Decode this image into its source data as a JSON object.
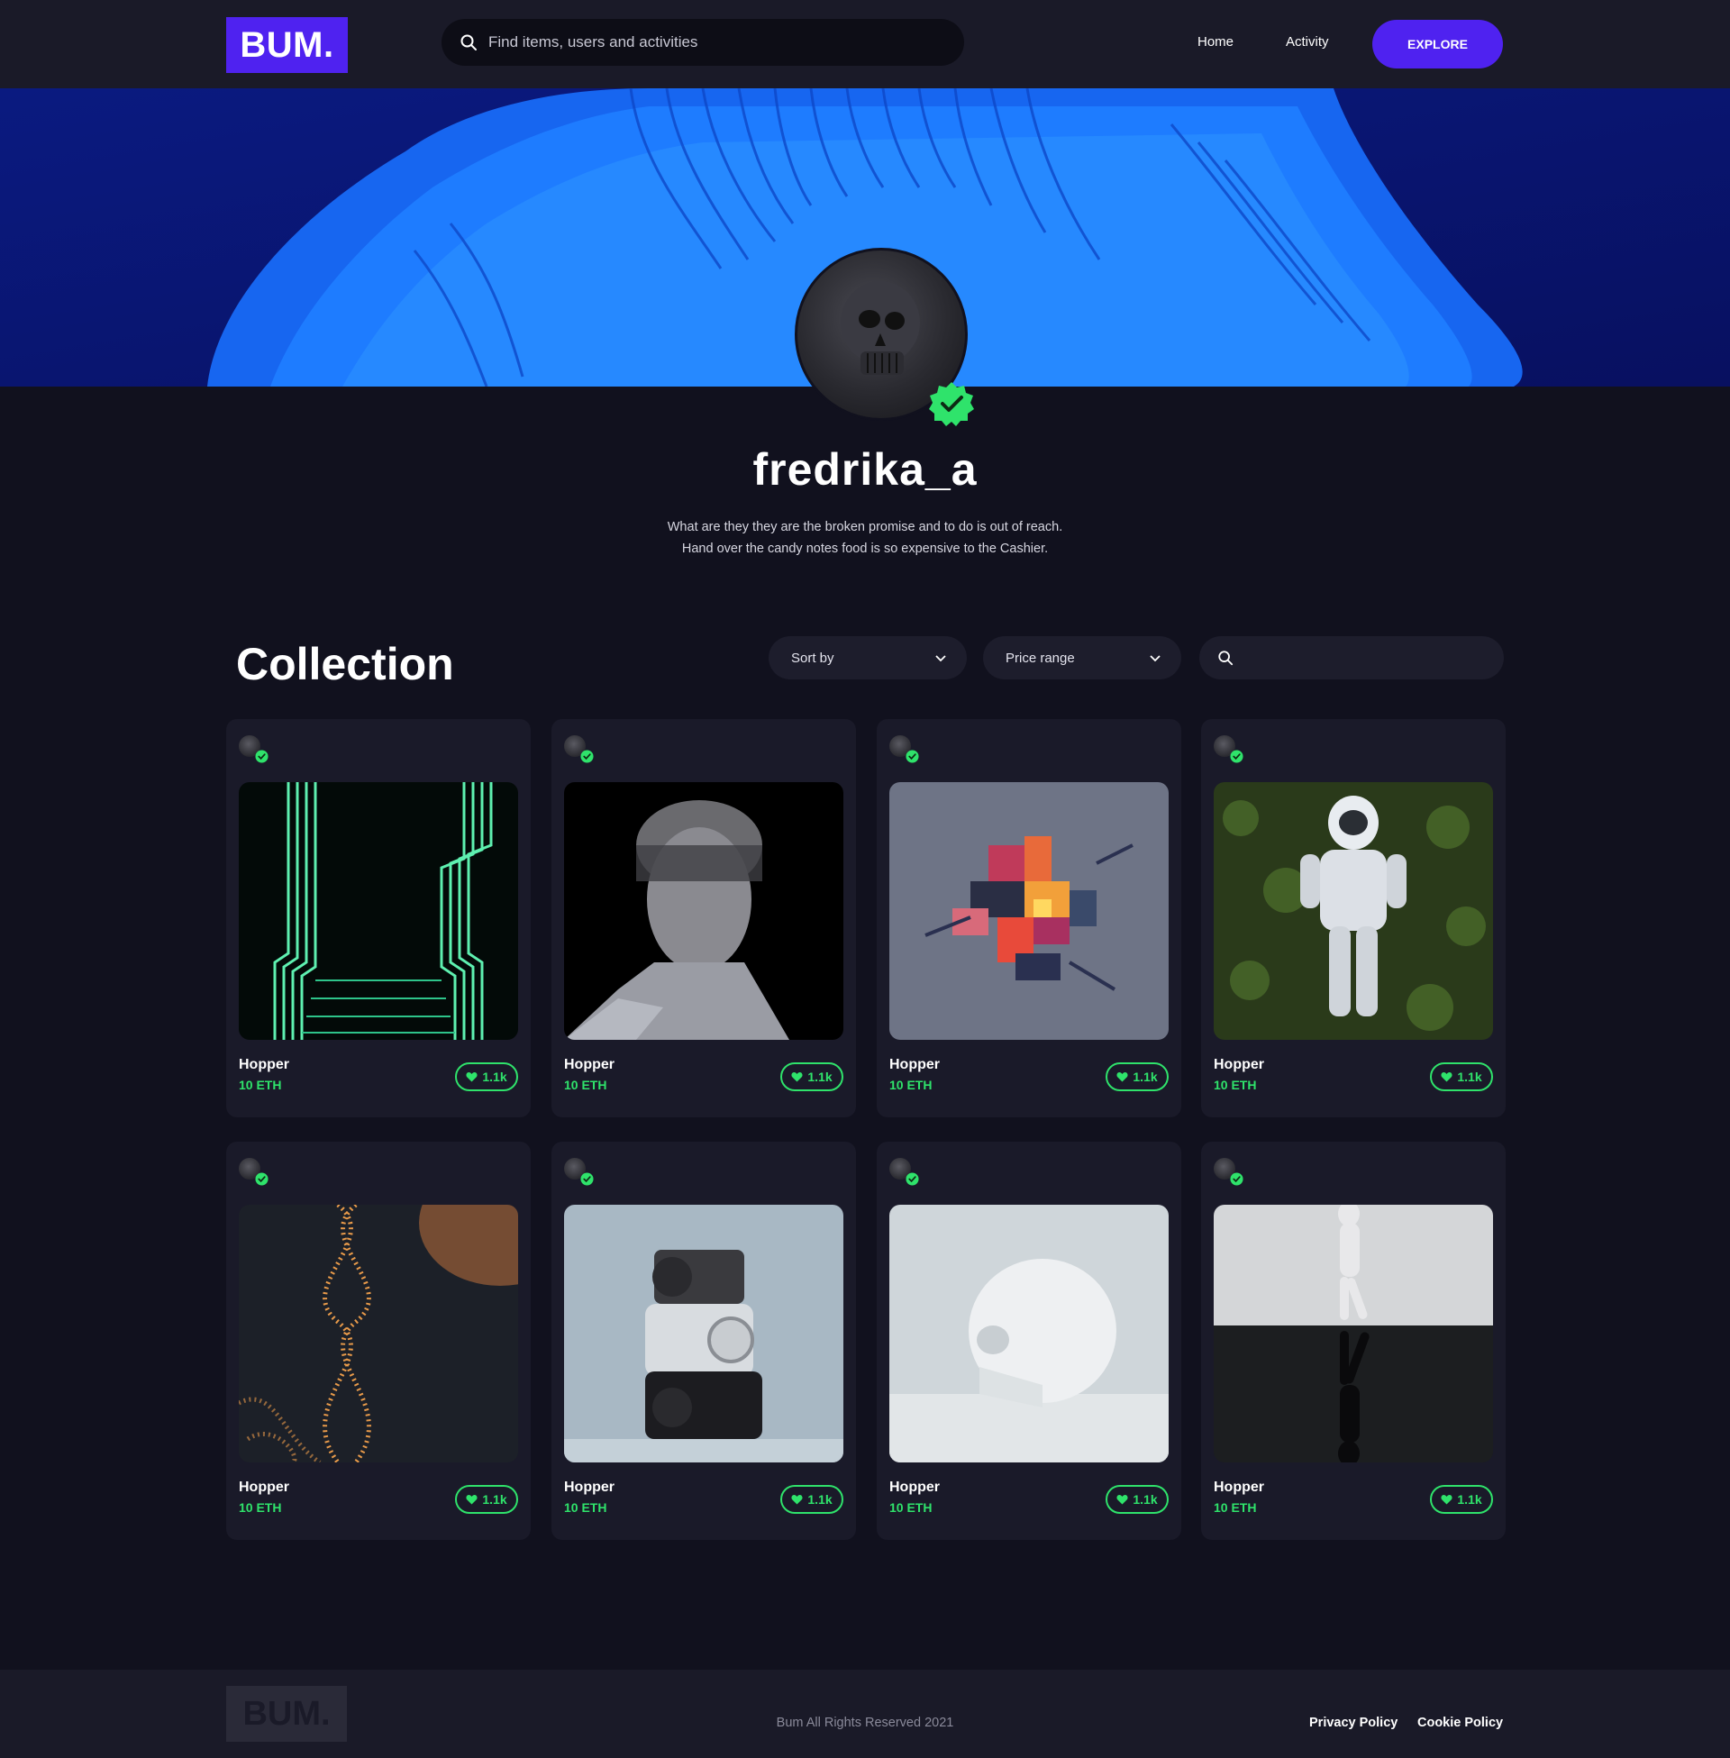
{
  "header": {
    "logo": "BUM.",
    "search_placeholder": "Find items, users and activities",
    "nav": {
      "home": "Home",
      "activity": "Activity",
      "explore": "EXPLORE"
    }
  },
  "profile": {
    "username": "fredrika_a",
    "bio_line1": "What are they they are the broken promise and to do is out of reach.",
    "bio_line2": "Hand over the candy notes food is so expensive to the Cashier."
  },
  "collection": {
    "title": "Collection",
    "sort_label": "Sort by",
    "price_label": "Price range",
    "items": [
      {
        "name": "Hopper",
        "price": "10 ETH",
        "likes": "1.1k",
        "art": "neon-corridor"
      },
      {
        "name": "Hopper",
        "price": "10 ETH",
        "likes": "1.1k",
        "art": "marble-bust"
      },
      {
        "name": "Hopper",
        "price": "10 ETH",
        "likes": "1.1k",
        "art": "voxel-cube"
      },
      {
        "name": "Hopper",
        "price": "10 ETH",
        "likes": "1.1k",
        "art": "astronaut"
      },
      {
        "name": "Hopper",
        "price": "10 ETH",
        "likes": "1.1k",
        "art": "dna-helix"
      },
      {
        "name": "Hopper",
        "price": "10 ETH",
        "likes": "1.1k",
        "art": "camera-sculpture"
      },
      {
        "name": "Hopper",
        "price": "10 ETH",
        "likes": "1.1k",
        "art": "white-skull"
      },
      {
        "name": "Hopper",
        "price": "10 ETH",
        "likes": "1.1k",
        "art": "mirror-figure"
      }
    ]
  },
  "footer": {
    "logo": "BUM.",
    "copyright": "Bum All Rights Reserved 2021",
    "privacy": "Privacy Policy",
    "cookie": "Cookie Policy"
  },
  "colors": {
    "accent": "#4f22f0",
    "success": "#2fe36b",
    "background": "#11111e",
    "card": "#1a1a29"
  }
}
